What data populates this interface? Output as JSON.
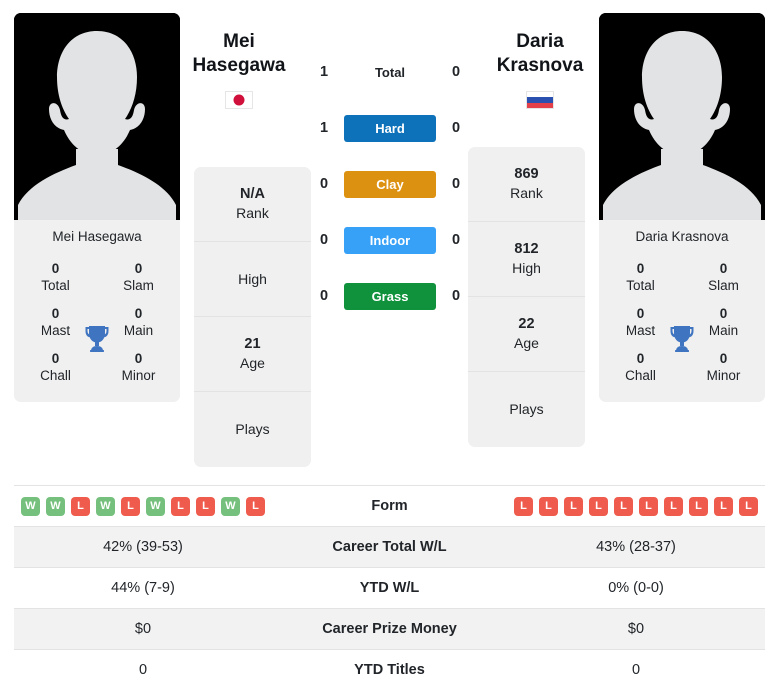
{
  "players": {
    "left": {
      "name_line1": "Mei",
      "name_line2": "Hasegawa",
      "full_name": "Mei Hasegawa",
      "country": "Japan",
      "flag_icon": "flag-japan-icon",
      "rank": "N/A",
      "rank_label": "Rank",
      "high": "",
      "high_label": "High",
      "age": "21",
      "age_label": "Age",
      "plays": "",
      "plays_label": "Plays",
      "titles": [
        {
          "value": "0",
          "label": "Total"
        },
        {
          "value": "0",
          "label": "Slam"
        },
        {
          "value": "0",
          "label": "Mast"
        },
        {
          "value": "0",
          "label": "Main"
        },
        {
          "value": "0",
          "label": "Chall"
        },
        {
          "value": "0",
          "label": "Minor"
        }
      ],
      "form": [
        "W",
        "W",
        "L",
        "W",
        "L",
        "W",
        "L",
        "L",
        "W",
        "L"
      ],
      "career_total_wl": "42% (39-53)",
      "ytd_wl": "44% (7-9)",
      "career_prize_money": "$0",
      "ytd_titles": "0"
    },
    "right": {
      "name_line1": "Daria",
      "name_line2": "Krasnova",
      "full_name": "Daria Krasnova",
      "country": "Russia",
      "flag_icon": "flag-russia-icon",
      "rank": "869",
      "rank_label": "Rank",
      "high": "812",
      "high_label": "High",
      "age": "22",
      "age_label": "Age",
      "plays": "",
      "plays_label": "Plays",
      "titles": [
        {
          "value": "0",
          "label": "Total"
        },
        {
          "value": "0",
          "label": "Slam"
        },
        {
          "value": "0",
          "label": "Mast"
        },
        {
          "value": "0",
          "label": "Main"
        },
        {
          "value": "0",
          "label": "Chall"
        },
        {
          "value": "0",
          "label": "Minor"
        }
      ],
      "form": [
        "L",
        "L",
        "L",
        "L",
        "L",
        "L",
        "L",
        "L",
        "L",
        "L"
      ],
      "career_total_wl": "43% (28-37)",
      "ytd_wl": "0% (0-0)",
      "career_prize_money": "$0",
      "ytd_titles": "0"
    }
  },
  "head_to_head": [
    {
      "label": "Total",
      "left": "1",
      "right": "0",
      "style": "plain",
      "color": ""
    },
    {
      "label": "Hard",
      "left": "1",
      "right": "0",
      "style": "badge",
      "color": "#0d72ba"
    },
    {
      "label": "Clay",
      "left": "0",
      "right": "0",
      "style": "badge",
      "color": "#dd9110"
    },
    {
      "label": "Indoor",
      "left": "0",
      "right": "0",
      "style": "badge",
      "color": "#36a1f7"
    },
    {
      "label": "Grass",
      "left": "0",
      "right": "0",
      "style": "badge",
      "color": "#10913c"
    }
  ],
  "comparison_rows": [
    {
      "label": "Form",
      "type": "form",
      "left": "",
      "right": ""
    },
    {
      "label": "Career Total W/L",
      "type": "text",
      "left": "42% (39-53)",
      "right": "43% (28-37)"
    },
    {
      "label": "YTD W/L",
      "type": "text",
      "left": "44% (7-9)",
      "right": "0% (0-0)"
    },
    {
      "label": "Career Prize Money",
      "type": "text",
      "left": "$0",
      "right": "$0"
    },
    {
      "label": "YTD Titles",
      "type": "text",
      "left": "0",
      "right": "0"
    }
  ],
  "colors": {
    "form_win": "#74c07c",
    "form_loss": "#ef5b4c",
    "trophy": "#3f74c0",
    "card_bg": "#f0f0f0",
    "row_alt_bg": "#f2f2f2"
  },
  "icons": {
    "trophy": "trophy-icon",
    "avatar": "avatar-placeholder-icon"
  }
}
